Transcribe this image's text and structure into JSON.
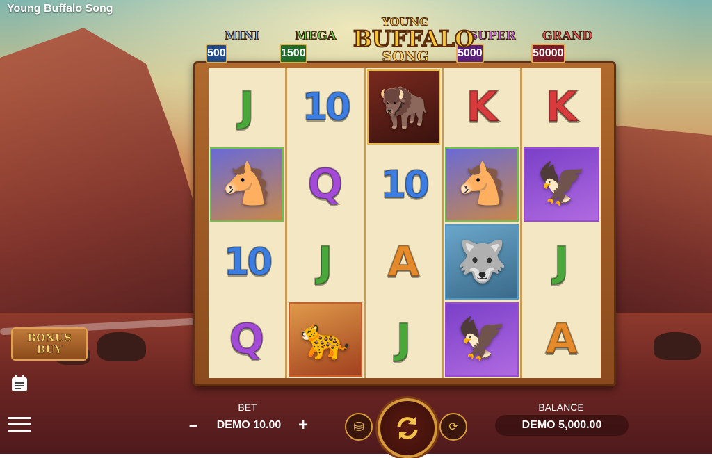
{
  "window": {
    "title": "Young Buffalo Song"
  },
  "logo": {
    "line1": "YOUNG",
    "line2": "BUFFALO",
    "line3": "SONG"
  },
  "jackpots": [
    {
      "name": "MINI",
      "value": "500",
      "color": "#7ab0e8",
      "panel": "#1f4a8a"
    },
    {
      "name": "MEGA",
      "value": "1500",
      "color": "#6ad04a",
      "panel": "#1f6a2a"
    },
    {
      "name": "SUPER",
      "value": "5000",
      "color": "#c86ae8",
      "panel": "#5a1f7a"
    },
    {
      "name": "GRAND",
      "value": "50000",
      "color": "#e85a5a",
      "panel": "#7a1f2a"
    }
  ],
  "reels": [
    [
      {
        "t": "letter",
        "v": "J",
        "c": "green"
      },
      {
        "t": "animal",
        "v": "horse",
        "icon": "🐴"
      },
      {
        "t": "letter",
        "v": "10",
        "c": "blue"
      },
      {
        "t": "letter",
        "v": "Q",
        "c": "purple"
      }
    ],
    [
      {
        "t": "letter",
        "v": "10",
        "c": "blue"
      },
      {
        "t": "letter",
        "v": "Q",
        "c": "purple"
      },
      {
        "t": "letter",
        "v": "J",
        "c": "green"
      },
      {
        "t": "animal",
        "v": "cougar",
        "icon": "🐆"
      }
    ],
    [
      {
        "t": "animal",
        "v": "buffalo",
        "icon": "🦬"
      },
      {
        "t": "letter",
        "v": "10",
        "c": "blue"
      },
      {
        "t": "letter",
        "v": "A",
        "c": "orange"
      },
      {
        "t": "letter",
        "v": "J",
        "c": "green"
      }
    ],
    [
      {
        "t": "letter",
        "v": "K",
        "c": "red"
      },
      {
        "t": "animal",
        "v": "horse",
        "icon": "🐴"
      },
      {
        "t": "animal",
        "v": "wolf",
        "icon": "🐺"
      },
      {
        "t": "animal",
        "v": "eagle",
        "icon": "🦅"
      }
    ],
    [
      {
        "t": "letter",
        "v": "K",
        "c": "red"
      },
      {
        "t": "animal",
        "v": "eagle",
        "icon": "🦅"
      },
      {
        "t": "letter",
        "v": "J",
        "c": "green"
      },
      {
        "t": "letter",
        "v": "A",
        "c": "orange"
      }
    ]
  ],
  "bonus_buy": {
    "line1": "BONUS",
    "line2": "BUY"
  },
  "bet": {
    "label": "BET",
    "value": "DEMO 10.00",
    "minus": "−",
    "plus": "+"
  },
  "balance": {
    "label": "BALANCE",
    "value": "DEMO 5,000.00"
  },
  "icons": {
    "menu": "hamburger-menu-icon",
    "paytable": "paytable-icon",
    "spin": "spin-arrows-icon",
    "autoplay": "autoplay-icon",
    "coin_settings": "coin-settings-icon"
  }
}
